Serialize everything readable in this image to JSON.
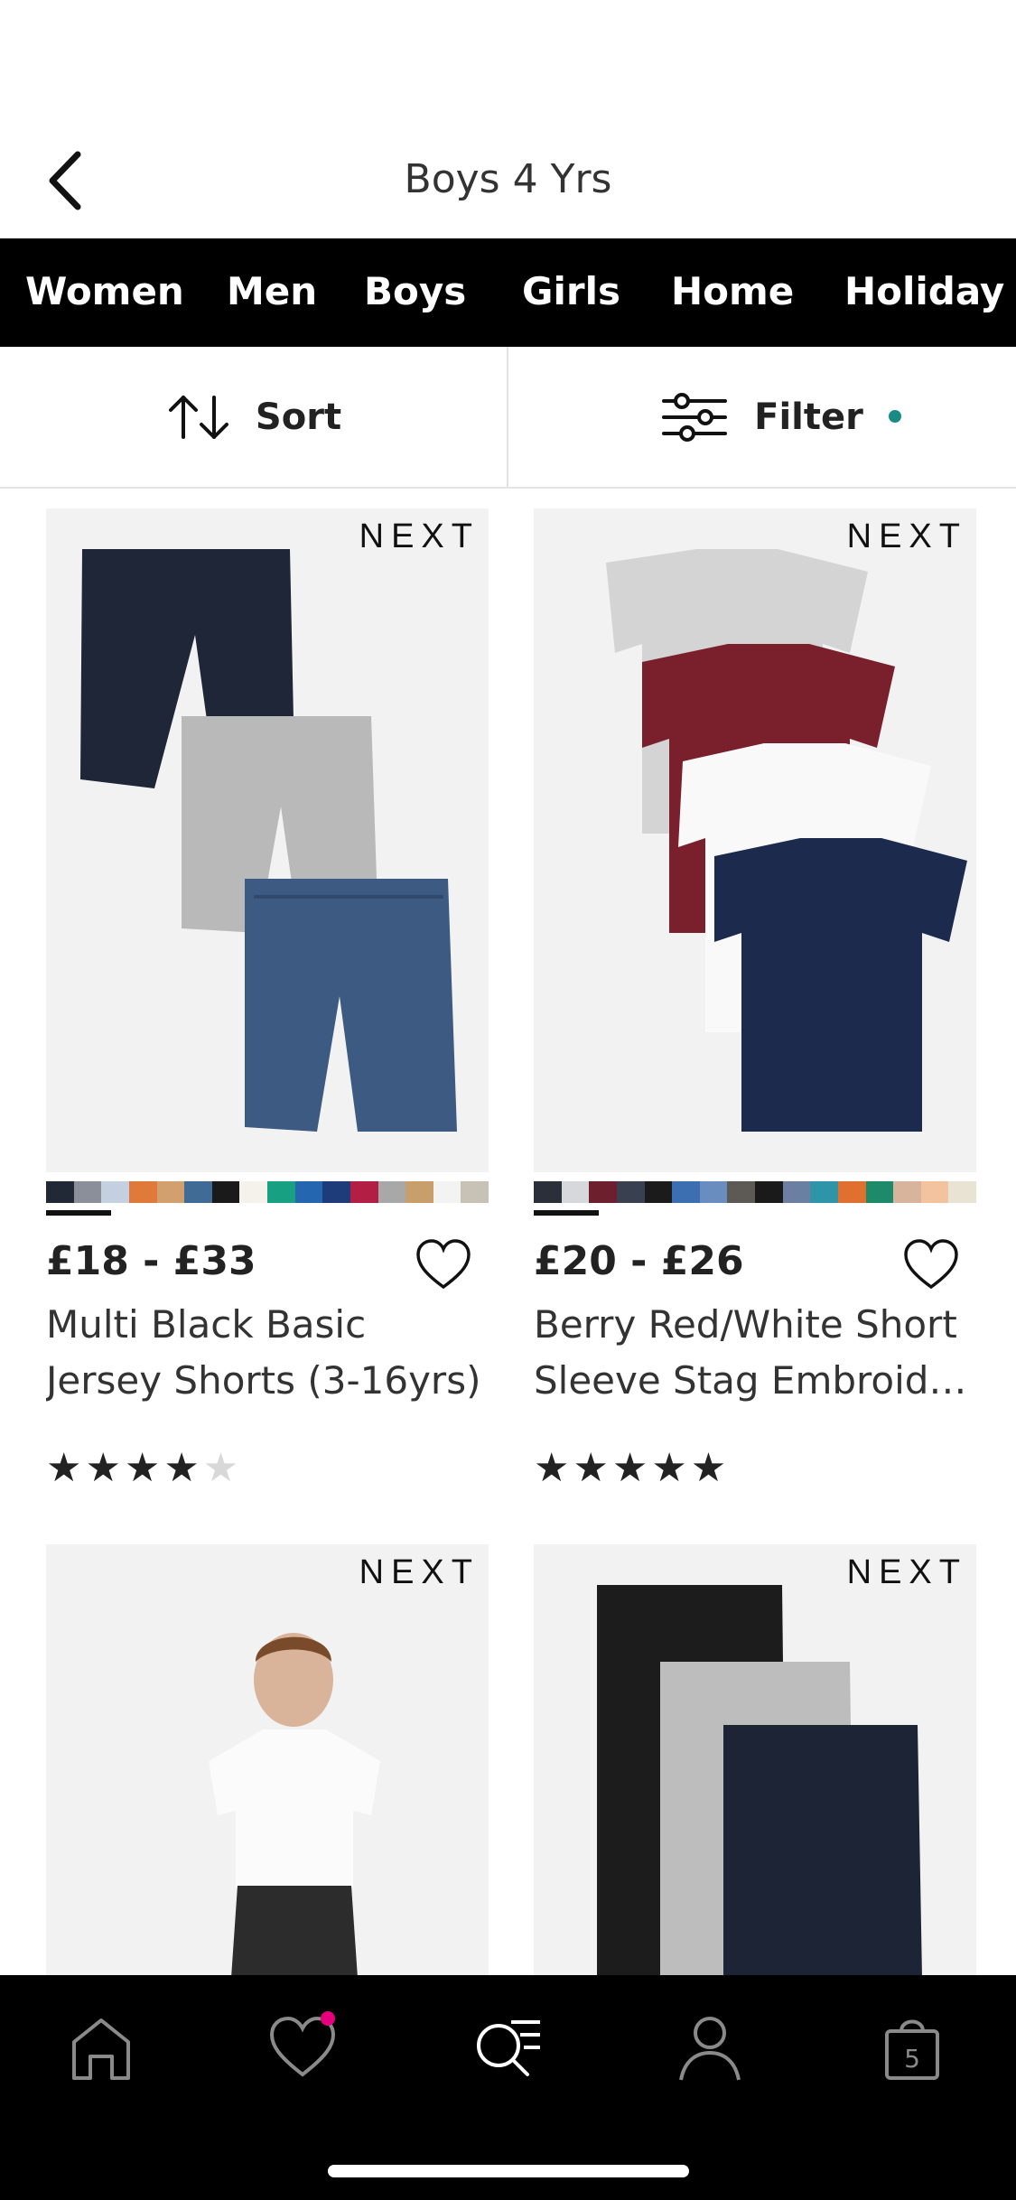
{
  "header": {
    "title": "Boys 4 Yrs"
  },
  "nav": [
    "Women",
    "Men",
    "Boys",
    "Girls",
    "Home",
    "Holiday"
  ],
  "toolbar": {
    "sort_label": "Sort",
    "filter_label": "Filter"
  },
  "products": [
    {
      "brand": "NEXT",
      "price": "£18 - £33",
      "name_line1": "Multi Black Basic",
      "name_line2": "Jersey Shorts (3-16yrs)",
      "rating": 4,
      "swatches": [
        "#222936",
        "#8a8f99",
        "#c4cfe0",
        "#e07a3b",
        "#d2a06e",
        "#3f6b95",
        "#1a1a1a",
        "#f4f2ea",
        "#18a083",
        "#2466b0",
        "#1f3c7a",
        "#b31e45",
        "#a8a8a8",
        "#c89f6a",
        "#f3f3f3",
        "#c7c2b5"
      ]
    },
    {
      "brand": "NEXT",
      "price": "£20 - £26",
      "name_line1": "Berry Red/White Short",
      "name_line2": "Sleeve Stag Embroidered",
      "rating": 5,
      "swatches": [
        "#2b2f3a",
        "#d7d8dc",
        "#6d1f2e",
        "#39404f",
        "#1b1b1b",
        "#3b6fb1",
        "#6a8dbf",
        "#5d5a56",
        "#1a1a1a",
        "#6a7fa1",
        "#2e95a8",
        "#e07030",
        "#1d8a6a",
        "#d8b49c",
        "#f3c3a0",
        "#e8e3d3"
      ]
    },
    {
      "brand": "NEXT"
    },
    {
      "brand": "NEXT"
    }
  ],
  "bottom_nav": [
    "home-icon",
    "heart-icon",
    "search-list-icon",
    "account-icon",
    "bag-icon"
  ],
  "bag_count": "5",
  "colors": {
    "accent_teal": "#1a8a85",
    "badge_pink": "#e6007e"
  }
}
